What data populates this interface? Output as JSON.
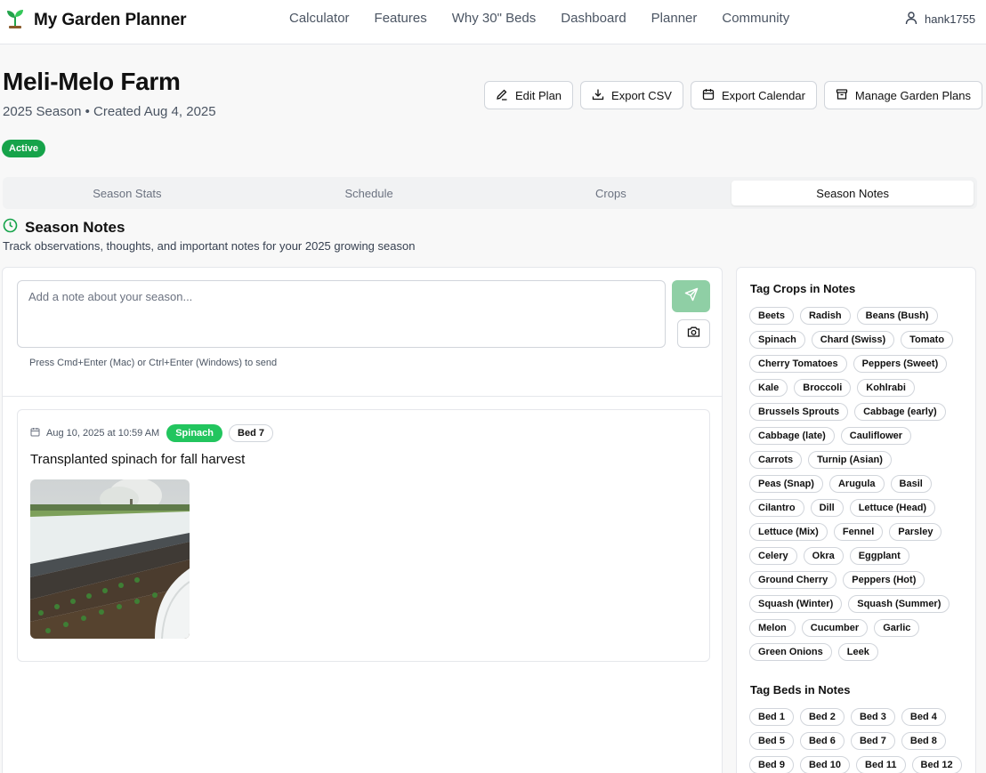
{
  "nav": {
    "brand": "My Garden Planner",
    "links": [
      "Calculator",
      "Features",
      "Why 30\" Beds",
      "Dashboard",
      "Planner",
      "Community"
    ],
    "username": "hank1755"
  },
  "plan": {
    "title": "Meli-Melo Farm",
    "subtitle": "2025 Season • Created Aug 4, 2025",
    "status": "Active"
  },
  "actions": {
    "edit": "Edit Plan",
    "export_csv": "Export CSV",
    "export_calendar": "Export Calendar",
    "manage": "Manage Garden Plans"
  },
  "tabs": [
    "Season Stats",
    "Schedule",
    "Crops",
    "Season Notes"
  ],
  "active_tab": "Season Notes",
  "section": {
    "title": "Season Notes",
    "description": "Track observations, thoughts, and important notes for your 2025 growing season"
  },
  "composer": {
    "placeholder": "Add a note about your season...",
    "value": "",
    "hint": "Press Cmd+Enter (Mac) or Ctrl+Enter (Windows) to send"
  },
  "notes": [
    {
      "date": "Aug 10, 2025 at 10:59 AM",
      "crop_tag": "Spinach",
      "bed_tag": "Bed 7",
      "text": "Transplanted spinach for fall harvest"
    }
  ],
  "sidebar": {
    "crops_title": "Tag Crops in Notes",
    "crops": [
      "Beets",
      "Radish",
      "Beans (Bush)",
      "Spinach",
      "Chard (Swiss)",
      "Tomato",
      "Cherry Tomatoes",
      "Peppers (Sweet)",
      "Kale",
      "Broccoli",
      "Kohlrabi",
      "Brussels Sprouts",
      "Cabbage (early)",
      "Cabbage (late)",
      "Cauliflower",
      "Carrots",
      "Turnip (Asian)",
      "Peas (Snap)",
      "Arugula",
      "Basil",
      "Cilantro",
      "Dill",
      "Lettuce (Head)",
      "Lettuce (Mix)",
      "Fennel",
      "Parsley",
      "Celery",
      "Okra",
      "Eggplant",
      "Ground Cherry",
      "Peppers (Hot)",
      "Squash (Winter)",
      "Squash (Summer)",
      "Melon",
      "Cucumber",
      "Garlic",
      "Green Onions",
      "Leek"
    ],
    "beds_title": "Tag Beds in Notes",
    "beds": [
      "Bed 1",
      "Bed 2",
      "Bed 3",
      "Bed 4",
      "Bed 5",
      "Bed 6",
      "Bed 7",
      "Bed 8",
      "Bed 9",
      "Bed 10",
      "Bed 11",
      "Bed 12"
    ]
  },
  "colors": {
    "accent": "#16a34a",
    "tag_green": "#22c55e",
    "send_button": "#8fcfa5"
  }
}
